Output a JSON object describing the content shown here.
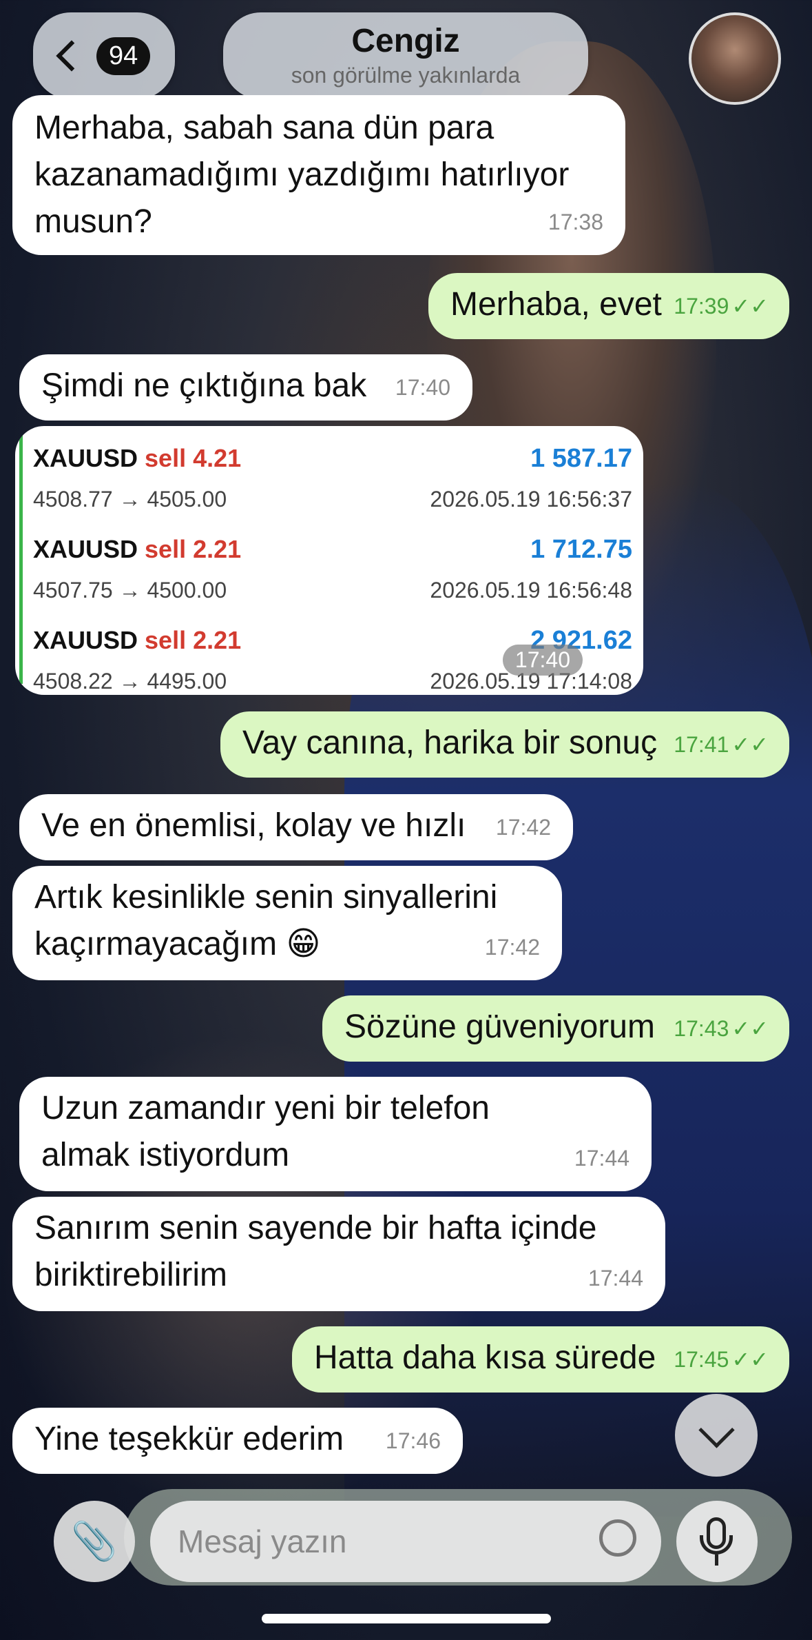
{
  "header": {
    "unread_count": "94",
    "contact_name": "Cengiz",
    "status": "son görülme yakınlarda"
  },
  "messages": [
    {
      "text": "Merhaba, sabah sana dün para kazanamadığımı yazdığımı hatırlıyor musun?",
      "time": "17:38"
    },
    {
      "text": "Merhaba, evet",
      "time": "17:39",
      "tick": "✓✓"
    },
    {
      "text": "Şimdi ne çıktığına bak",
      "time": "17:40"
    },
    {
      "text": "Vay canına, harika bir sonuç",
      "time": "17:41",
      "tick": "✓✓"
    },
    {
      "text": "Ve en önemlisi, kolay ve hızlı",
      "time": "17:42"
    },
    {
      "text": "Artık kesinlikle senin sinyallerini kaçırmayacağım 😁",
      "time": "17:42"
    },
    {
      "text": "Sözüne güveniyorum",
      "time": "17:43",
      "tick": "✓✓"
    },
    {
      "text": "Uzun zamandır yeni bir telefon almak istiyordum",
      "time": "17:44"
    },
    {
      "text": "Sanırım senin sayende bir hafta içinde biriktirebilirim",
      "time": "17:44"
    },
    {
      "text": "Hatta daha kısa sürede",
      "time": "17:45",
      "tick": "✓✓"
    },
    {
      "text": "Yine teşekkür ederim",
      "time": "17:46"
    }
  ],
  "trade_card": {
    "time": "17:40",
    "trades": [
      {
        "symbol": "XAUUSD",
        "side": "sell 4.21",
        "profit": "1 587.17",
        "prices": "4508.77 → 4505.00",
        "date": "2026.05.19 16:56:37"
      },
      {
        "symbol": "XAUUSD",
        "side": "sell 2.21",
        "profit": "1 712.75",
        "prices": "4507.75 → 4500.00",
        "date": "2026.05.19 16:56:48"
      },
      {
        "symbol": "XAUUSD",
        "side": "sell 2.21",
        "profit": "2 921.62",
        "prices": "4508.22 → 4495.00",
        "date": "2026.05.19 17:14:08"
      }
    ]
  },
  "input": {
    "placeholder": "Mesaj yazın"
  },
  "icons": {
    "back": "chevron-left-icon",
    "attach": "paperclip-icon",
    "sticker": "sticker-icon",
    "mic": "microphone-icon",
    "scroll": "chevron-down-icon"
  },
  "colors": {
    "outgoing_bubble": "#dbf7c2",
    "incoming_bubble": "#ffffff",
    "profit": "#1a7fd6",
    "sell": "#d23b2f",
    "read_tick": "#4aa43f"
  }
}
